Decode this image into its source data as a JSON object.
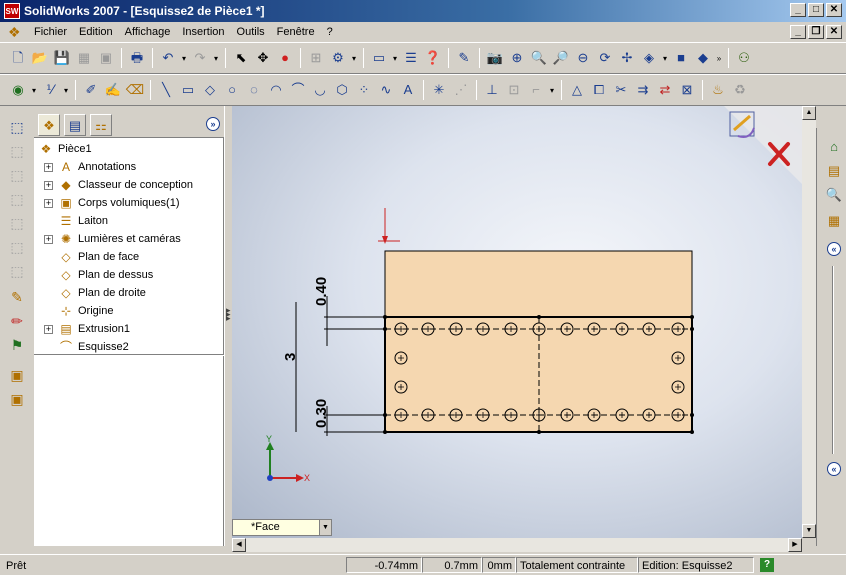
{
  "window": {
    "title": "SolidWorks 2007 - [Esquisse2 de Pièce1 *]",
    "app_icon_text": "SW",
    "buttons": [
      "_",
      "□",
      "✕"
    ],
    "doc_buttons": [
      "_",
      "❐",
      "✕"
    ]
  },
  "menu": {
    "items": [
      "Fichier",
      "Edition",
      "Affichage",
      "Insertion",
      "Outils",
      "Fenêtre",
      "?"
    ]
  },
  "feature_manager": {
    "tabs": [
      "feature-tree",
      "property-manager",
      "configuration-manager"
    ],
    "expand_label": "»",
    "tree": [
      {
        "label": "Pièce1",
        "icon": "part-icon",
        "expandable": false,
        "level": 0
      },
      {
        "label": "Annotations",
        "icon": "annotations-icon",
        "expandable": true,
        "level": 1
      },
      {
        "label": "Classeur de conception",
        "icon": "design-binder-icon",
        "expandable": true,
        "level": 1
      },
      {
        "label": "Corps volumiques(1)",
        "icon": "solid-bodies-icon",
        "expandable": true,
        "level": 1
      },
      {
        "label": "Laiton",
        "icon": "material-icon",
        "expandable": false,
        "level": 1
      },
      {
        "label": "Lumières et caméras",
        "icon": "lights-icon",
        "expandable": true,
        "level": 1
      },
      {
        "label": "Plan de face",
        "icon": "plane-icon",
        "expandable": false,
        "level": 1
      },
      {
        "label": "Plan de dessus",
        "icon": "plane-icon",
        "expandable": false,
        "level": 1
      },
      {
        "label": "Plan de droite",
        "icon": "plane-icon",
        "expandable": false,
        "level": 1
      },
      {
        "label": "Origine",
        "icon": "origin-icon",
        "expandable": false,
        "level": 1
      },
      {
        "label": "Extrusion1",
        "icon": "extrude-icon",
        "expandable": true,
        "level": 1
      },
      {
        "label": "Esquisse2",
        "icon": "sketch-icon",
        "expandable": false,
        "level": 1
      }
    ]
  },
  "viewport": {
    "dimensions": {
      "d_top": "0.40",
      "d_height": "3",
      "d_bottom": "0.30"
    },
    "axes": {
      "x": "X",
      "y": "Y"
    },
    "view_name": "*Face"
  },
  "statusbar": {
    "ready": "Prêt",
    "x": "-0.74mm",
    "y": "0.7mm",
    "z": "0mm",
    "constraint": "Totalement contrainte",
    "edit": "Edition: Esquisse2",
    "help": "?"
  },
  "colors": {
    "face": "#f5d7b0",
    "sketch": "#000000",
    "title_start": "#0a246a",
    "accent_red": "#cc2222"
  }
}
